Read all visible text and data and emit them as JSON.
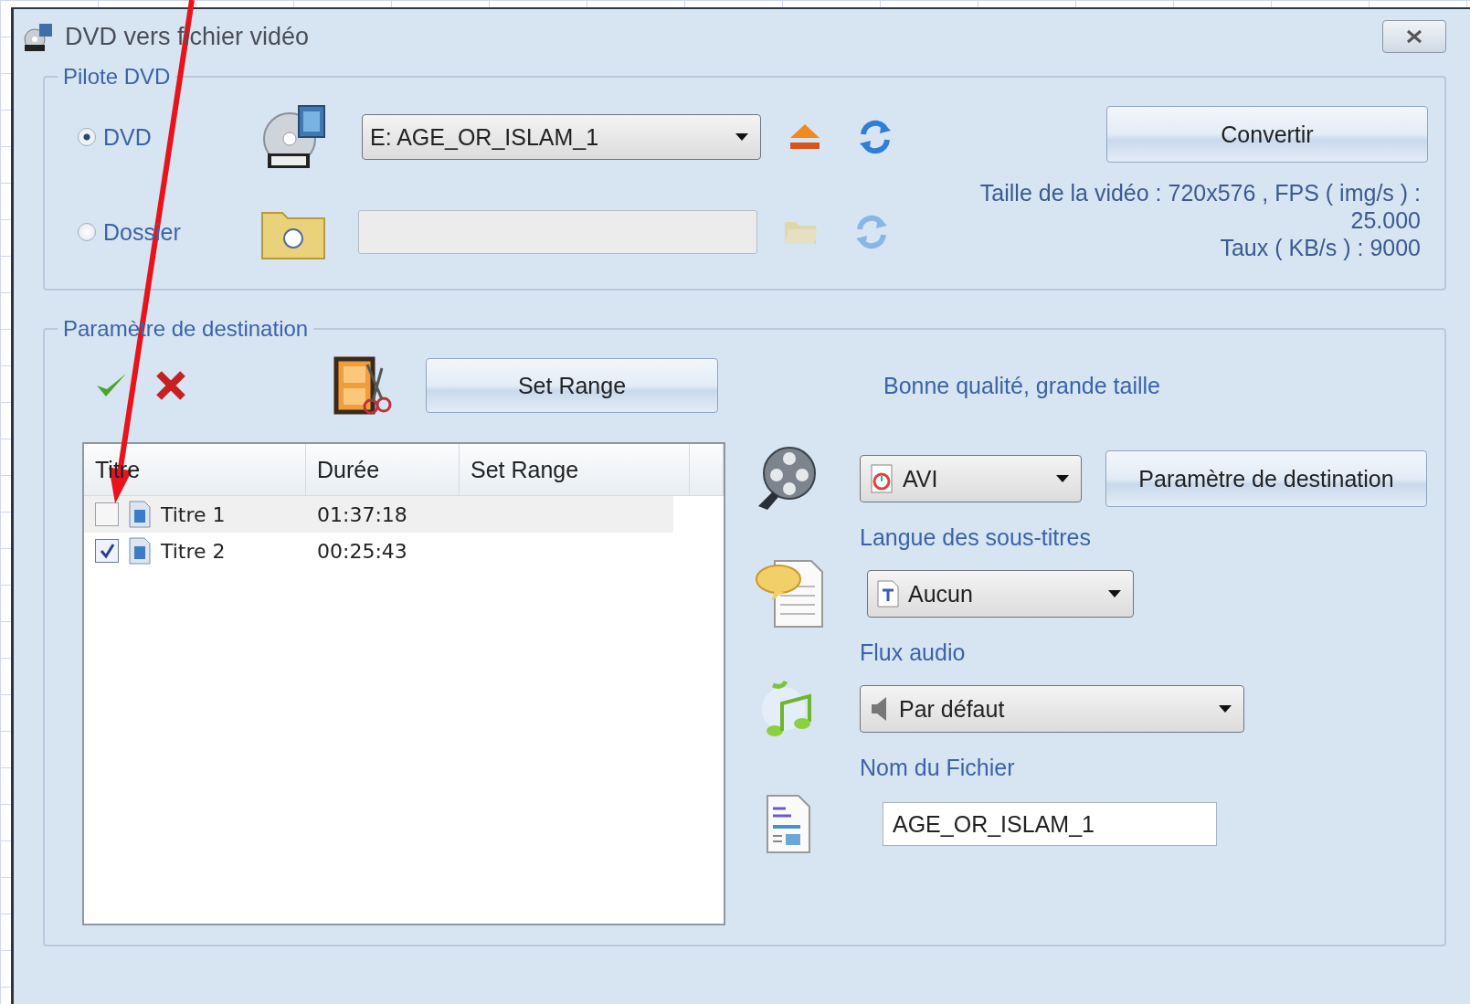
{
  "window": {
    "title": "DVD vers fichier vidéo"
  },
  "drive_group": {
    "legend": "Pilote DVD",
    "sources": [
      {
        "kind": "dvd",
        "label": "DVD",
        "selected": true,
        "value": "E:  AGE_OR_ISLAM_1",
        "disabled": false
      },
      {
        "kind": "folder",
        "label": "Dossier",
        "selected": false,
        "disabled": true
      }
    ],
    "convert_button": "Convertir",
    "video_info": [
      "Taille de la vidéo : 720x576 , FPS ( img/s ) :",
      "25.000",
      "Taux ( KB/s ) : 9000"
    ]
  },
  "destination_group": {
    "legend": "Paramètre de destination",
    "set_range_button": "Set Range",
    "quality": "Bonne qualité, grande taille",
    "table": {
      "columns": [
        "Titre",
        "Durée",
        "Set Range"
      ],
      "rows": [
        {
          "checked": false,
          "selected": true,
          "title": "Titre 1",
          "duration": "01:37:18"
        },
        {
          "checked": true,
          "selected": false,
          "title": "Titre 2",
          "duration": "00:25:43"
        }
      ]
    },
    "format": {
      "value": "AVI"
    },
    "destination_button": "Paramètre de destination",
    "subtitles": {
      "label": "Langue des sous-titres",
      "value": "Aucun"
    },
    "audio": {
      "label": "Flux audio",
      "value": "Par défaut"
    },
    "filename": {
      "label": "Nom du Fichier",
      "value": "AGE_OR_ISLAM_1"
    }
  }
}
